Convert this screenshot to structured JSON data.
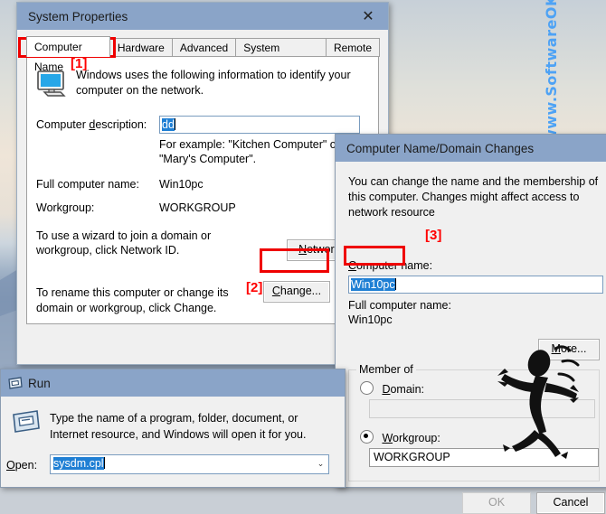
{
  "desktop": {
    "watermark_vertical": "www.SoftwareOK.com :-)",
    "watermark_inline": "www.SoftwareOK.com :-)",
    "accent_blue": "#4da2f5"
  },
  "system_properties": {
    "title": "System Properties",
    "close_label": "✕",
    "tabs": [
      {
        "label": "Computer Name",
        "selected": true
      },
      {
        "label": "Hardware",
        "selected": false
      },
      {
        "label": "Advanced",
        "selected": false
      },
      {
        "label": "System Protection",
        "selected": false
      },
      {
        "label": "Remote",
        "selected": false
      }
    ],
    "intro": "Windows uses the following information to identify your computer on the network.",
    "computer_description_label": "Computer description:",
    "computer_description_value": "dd",
    "example_hint": "For example: \"Kitchen Computer\" or \"Mary's Computer\".",
    "full_computer_name_label": "Full computer name:",
    "full_computer_name_value": "Win10pc",
    "workgroup_label": "Workgroup:",
    "workgroup_value": "WORKGROUP",
    "network_id_text": "To use a wizard to join a domain or workgroup, click Network ID.",
    "network_id_button": "Network ID",
    "change_text": "To rename this computer or change its domain or workgroup, click Change.",
    "change_button": "Change..."
  },
  "annotations": {
    "marker_1": "[1]",
    "marker_2": "[2]",
    "marker_3": "[3]",
    "color": "#ef0000"
  },
  "computer_name_domain_changes": {
    "title": "Computer Name/Domain Changes",
    "description": "You can change the name and the membership of this computer. Changes might affect access to network resource",
    "computer_name_label": "Computer name:",
    "computer_name_value": "Win10pc",
    "full_computer_name_label": "Full computer name:",
    "full_computer_name_value": "Win10pc",
    "more_button": "More...",
    "member_of_label": "Member of",
    "domain_label": "Domain:",
    "domain_value": "",
    "domain_selected": false,
    "workgroup_label": "Workgroup:",
    "workgroup_value": "WORKGROUP",
    "workgroup_selected": true,
    "ok_button": "OK",
    "ok_enabled": false,
    "cancel_button": "Cancel"
  },
  "run_dialog": {
    "title": "Run",
    "description": "Type the name of a program, folder, document, or Internet resource, and Windows will open it for you.",
    "open_label": "Open:",
    "open_value": "sysdm.cpl",
    "dropdown_arrow": "⌄"
  }
}
